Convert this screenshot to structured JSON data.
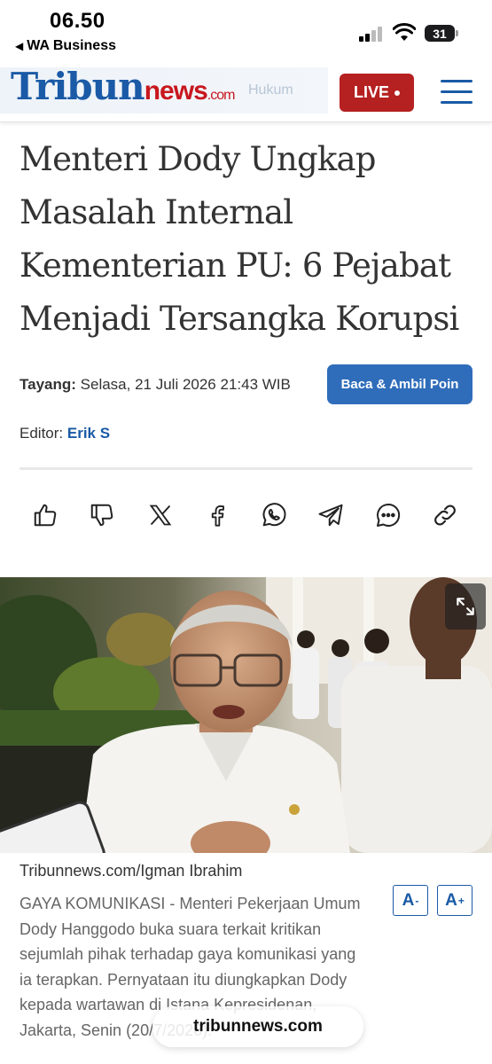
{
  "status_bar": {
    "time": "06.50",
    "back_app": "WA Business",
    "battery": "31"
  },
  "header": {
    "logo": {
      "part1": "Tribun",
      "part2": "news",
      "part3": ".com"
    },
    "breadcrumb": "Hukum",
    "live_label": "LIVE",
    "colors": {
      "brand_blue": "#1a5aa6",
      "brand_red": "#c8171e",
      "live_bg": "#b52020"
    }
  },
  "article": {
    "title": "Menteri Dody Ungkap Masalah Internal Kementerian PU: 6 Pejabat Menjadi Tersangka Korupsi",
    "published_label": "Tayang:",
    "published_value": "Selasa, 21 Juli 2026 21:43 WIB",
    "read_button": "Baca & Ambil Poin",
    "editor_label": "Editor:",
    "editor_name": "Erik S"
  },
  "share_icons": [
    "thumbs-up-icon",
    "thumbs-down-icon",
    "x-icon",
    "facebook-icon",
    "whatsapp-icon",
    "telegram-icon",
    "comment-icon",
    "link-icon"
  ],
  "photo": {
    "credit": "Tribunnews.com/Igman Ibrahim"
  },
  "caption": "GAYA KOMUNIKASI - Menteri Pekerjaan Umum Dody Hanggodo buka suara terkait kritikan sejumlah pihak terhadap gaya komunikasi yang ia terapkan. Pernyataan itu diungkapkan Dody kepada wartawan di Istana Kepresidenan, Jakarta, Senin (20/7/2026).",
  "font_controls": {
    "decrease": "A",
    "decrease_sup": "-",
    "increase": "A",
    "increase_sup": "+"
  },
  "browser": {
    "url": "tribunnews.com"
  }
}
